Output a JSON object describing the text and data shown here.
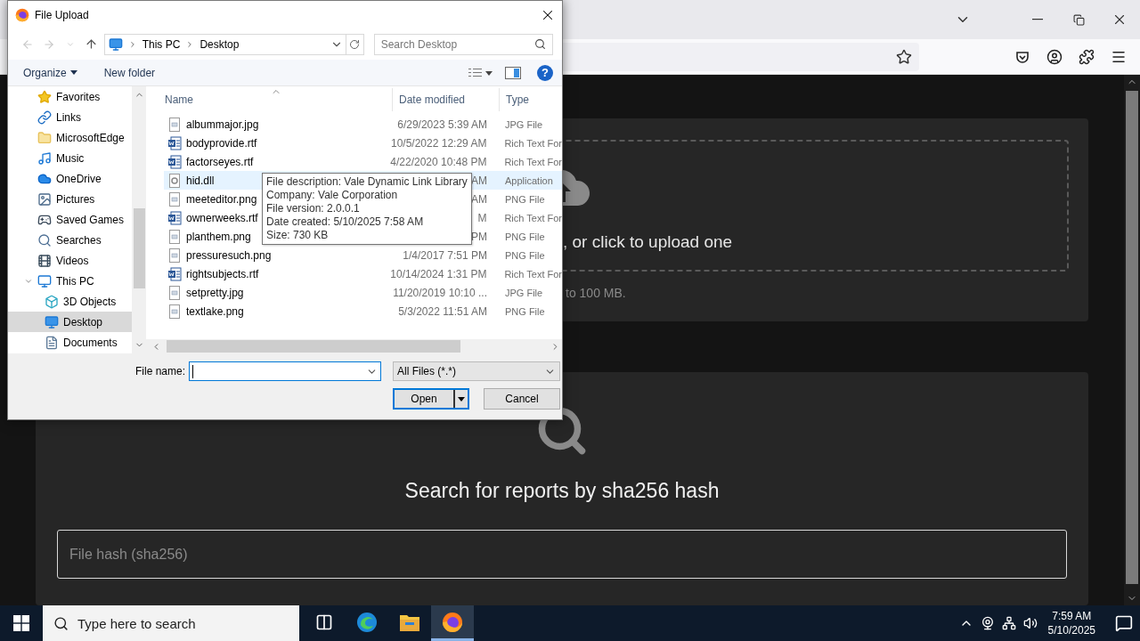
{
  "page": {
    "upload_card": {
      "prompt": ", or click to upload one",
      "note": "to 100 MB."
    },
    "search_card": {
      "title": "Search for reports by sha256 hash",
      "placeholder": "File hash (sha256)"
    }
  },
  "dialog": {
    "title": "File Upload",
    "breadcrumbs": [
      "This PC",
      "Desktop"
    ],
    "search_placeholder": "Search Desktop",
    "toolbar": {
      "organize": "Organize",
      "new_folder": "New folder",
      "help": "?"
    },
    "nav": [
      {
        "label": "Favorites",
        "kind": "star",
        "selected": false
      },
      {
        "label": "Links",
        "kind": "link",
        "selected": false
      },
      {
        "label": "MicrosoftEdge",
        "kind": "folder",
        "selected": false
      },
      {
        "label": "Music",
        "kind": "music",
        "selected": false
      },
      {
        "label": "OneDrive",
        "kind": "cloud",
        "selected": false
      },
      {
        "label": "Pictures",
        "kind": "pictures",
        "selected": false
      },
      {
        "label": "Saved Games",
        "kind": "games",
        "selected": false
      },
      {
        "label": "Searches",
        "kind": "search",
        "selected": false
      },
      {
        "label": "Videos",
        "kind": "videos",
        "selected": false
      },
      {
        "label": "This PC",
        "kind": "pc",
        "selected": false,
        "expanded": true,
        "children": [
          {
            "label": "3D Objects",
            "kind": "objects",
            "selected": false
          },
          {
            "label": "Desktop",
            "kind": "desktop",
            "selected": true
          },
          {
            "label": "Documents",
            "kind": "documents",
            "selected": false
          }
        ]
      }
    ],
    "columns": [
      "Name",
      "Date modified",
      "Type"
    ],
    "files": [
      {
        "name": "albummajor.jpg",
        "date": "6/29/2023 5:39 AM",
        "type": "JPG File",
        "kind": "image",
        "selected": false
      },
      {
        "name": "bodyprovide.rtf",
        "date": "10/5/2022 12:29 AM",
        "type": "Rich Text For",
        "kind": "rtf",
        "selected": false
      },
      {
        "name": "factorseyes.rtf",
        "date": "4/22/2020 10:48 PM",
        "type": "Rich Text For",
        "kind": "rtf",
        "selected": false
      },
      {
        "name": "hid.dll",
        "date": "AM",
        "type": "Application",
        "kind": "dll",
        "selected": true
      },
      {
        "name": "meeteditor.png",
        "date": "AM",
        "type": "PNG File",
        "kind": "image",
        "selected": false
      },
      {
        "name": "ownerweeks.rtf",
        "date": "M",
        "type": "Rich Text For",
        "kind": "rtf",
        "selected": false
      },
      {
        "name": "planthem.png",
        "date": "PM",
        "type": "PNG File",
        "kind": "image",
        "selected": false
      },
      {
        "name": "pressuresuch.png",
        "date": "1/4/2017 7:51 PM",
        "type": "PNG File",
        "kind": "image",
        "selected": false
      },
      {
        "name": "rightsubjects.rtf",
        "date": "10/14/2024 1:31 PM",
        "type": "Rich Text For",
        "kind": "rtf",
        "selected": false
      },
      {
        "name": "setpretty.jpg",
        "date": "11/20/2019 10:10 ...",
        "type": "JPG File",
        "kind": "image",
        "selected": false
      },
      {
        "name": "textlake.png",
        "date": "5/3/2022 11:51 AM",
        "type": "PNG File",
        "kind": "image",
        "selected": false
      }
    ],
    "tooltip": [
      "File description: Vale Dynamic Link Library",
      "Company: Vale Corporation",
      "File version: 2.0.0.1",
      "Date created: 5/10/2025 7:58 AM",
      "Size: 730 KB"
    ],
    "file_name_label": "File name:",
    "filter": "All Files (*.*)",
    "open": "Open",
    "cancel": "Cancel"
  },
  "taskbar": {
    "search_placeholder": "Type here to search",
    "apps": [
      {
        "kind": "taskview",
        "selected": false
      },
      {
        "kind": "edge",
        "selected": false
      },
      {
        "kind": "explorer",
        "selected": false
      },
      {
        "kind": "firefox",
        "selected": true
      }
    ],
    "time": "7:59 AM",
    "date": "5/10/2025"
  }
}
